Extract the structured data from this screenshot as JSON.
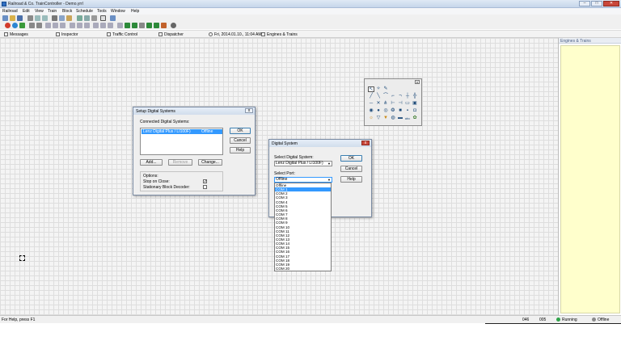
{
  "window": {
    "title": "Railroad & Co. TrainController - Demo.yrrl"
  },
  "menu": [
    "Railroad",
    "Edit",
    "View",
    "Train",
    "Block",
    "Schedule",
    "Tools",
    "Window",
    "Help"
  ],
  "tabs": {
    "messages": "Messages",
    "inspector": "Inspector",
    "traffic_control": "Traffic Control",
    "dispatcher": "Dispatcher",
    "clock": "Fri, 2014.01.10., 11:04 AM",
    "engines_trains": "Engines & Trains"
  },
  "right_panel": {
    "title": "Engines & Trains"
  },
  "setup_dialog": {
    "title": "Setup Digital Systems",
    "connected_label": "Connected Digital Systems:",
    "system_name": "Lenz Digital Plus / LI100F)",
    "system_status": "Offline",
    "ok": "OK",
    "cancel": "Cancel",
    "help": "Help",
    "add": "Add...",
    "remove": "Remove",
    "change": "Change...",
    "options_label": "Options:",
    "stop_on_close": "Stop on Close:",
    "stationary_block_decoder": "Stationary Block Decoder:"
  },
  "digital_dialog": {
    "title": "Digital System",
    "select_system_label": "Select Digital System:",
    "selected_system": "Lenz Digital Plus / LI100F)",
    "select_port_label": "Select Port:",
    "selected_port": "Offline",
    "ok": "OK",
    "cancel": "Cancel",
    "help": "Help"
  },
  "port_options": [
    "Offline",
    "COM 1",
    "COM 2",
    "COM 3",
    "COM 4",
    "COM 5",
    "COM 6",
    "COM 7",
    "COM 8",
    "COM 9",
    "COM 10",
    "COM 11",
    "COM 12",
    "COM 13",
    "COM 14",
    "COM 15",
    "COM 16",
    "COM 17",
    "COM 18",
    "COM 19",
    "COM 20"
  ],
  "port_highlighted": "COM 1",
  "statusbar": {
    "help_text": "For Help, press F1",
    "num1": "046",
    "num2": "005",
    "running": "Running",
    "offline": "Offline"
  },
  "colors": {
    "accent": "#3399ff",
    "panel_yellow": "#ffffcc",
    "running": "#2fa34a",
    "offline": "#8a8a8a"
  }
}
